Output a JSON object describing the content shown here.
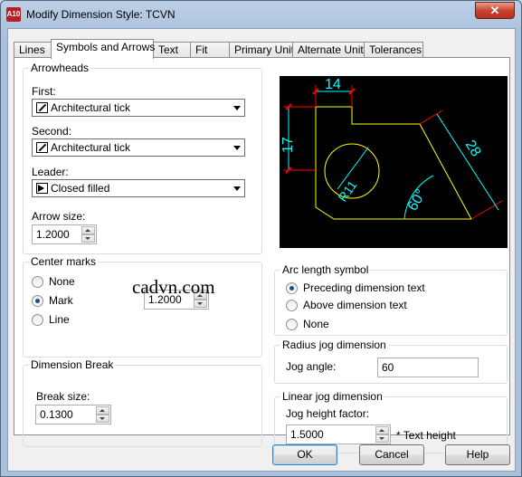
{
  "window": {
    "title": "Modify Dimension Style: TCVN",
    "app_icon_text": "A10",
    "close_label": "✕"
  },
  "tabs": [
    {
      "label": "Lines"
    },
    {
      "label": "Symbols and Arrows"
    },
    {
      "label": "Text"
    },
    {
      "label": "Fit"
    },
    {
      "label": "Primary Units"
    },
    {
      "label": "Alternate Units"
    },
    {
      "label": "Tolerances"
    }
  ],
  "arrowheads": {
    "title": "Arrowheads",
    "first_label": "First:",
    "first_value": "Architectural tick",
    "second_label": "Second:",
    "second_value": "Architectural tick",
    "leader_label": "Leader:",
    "leader_value": "Closed filled",
    "arrow_size_label": "Arrow size:",
    "arrow_size_value": "1.2000"
  },
  "center_marks": {
    "title": "Center marks",
    "none_label": "None",
    "mark_label": "Mark",
    "line_label": "Line",
    "selected": "Mark",
    "size_value": "1.2000"
  },
  "dimension_break": {
    "title": "Dimension Break",
    "break_size_label": "Break size:",
    "break_size_value": "0.1300"
  },
  "watermark": "cadvn.com",
  "preview": {
    "dim_top": "14",
    "dim_left": "17",
    "dim_radius": "R11",
    "dim_angle": "60°",
    "dim_slant": "28"
  },
  "arc_length": {
    "title": "Arc length symbol",
    "preceding_label": "Preceding dimension text",
    "above_label": "Above dimension text",
    "none_label": "None",
    "selected": "Preceding dimension text"
  },
  "radius_jog": {
    "title": "Radius jog dimension",
    "jog_angle_label": "Jog angle:",
    "jog_angle_value": "60"
  },
  "linear_jog": {
    "title": "Linear jog dimension",
    "height_factor_label": "Jog height factor:",
    "height_factor_value": "1.5000",
    "suffix": "* Text height"
  },
  "buttons": {
    "ok": "OK",
    "cancel": "Cancel",
    "help": "Help"
  },
  "colors": {
    "preview_background": "#000000",
    "geometry": "#ffff00",
    "dimension": "#00ffff",
    "extension": "#ff0000"
  }
}
